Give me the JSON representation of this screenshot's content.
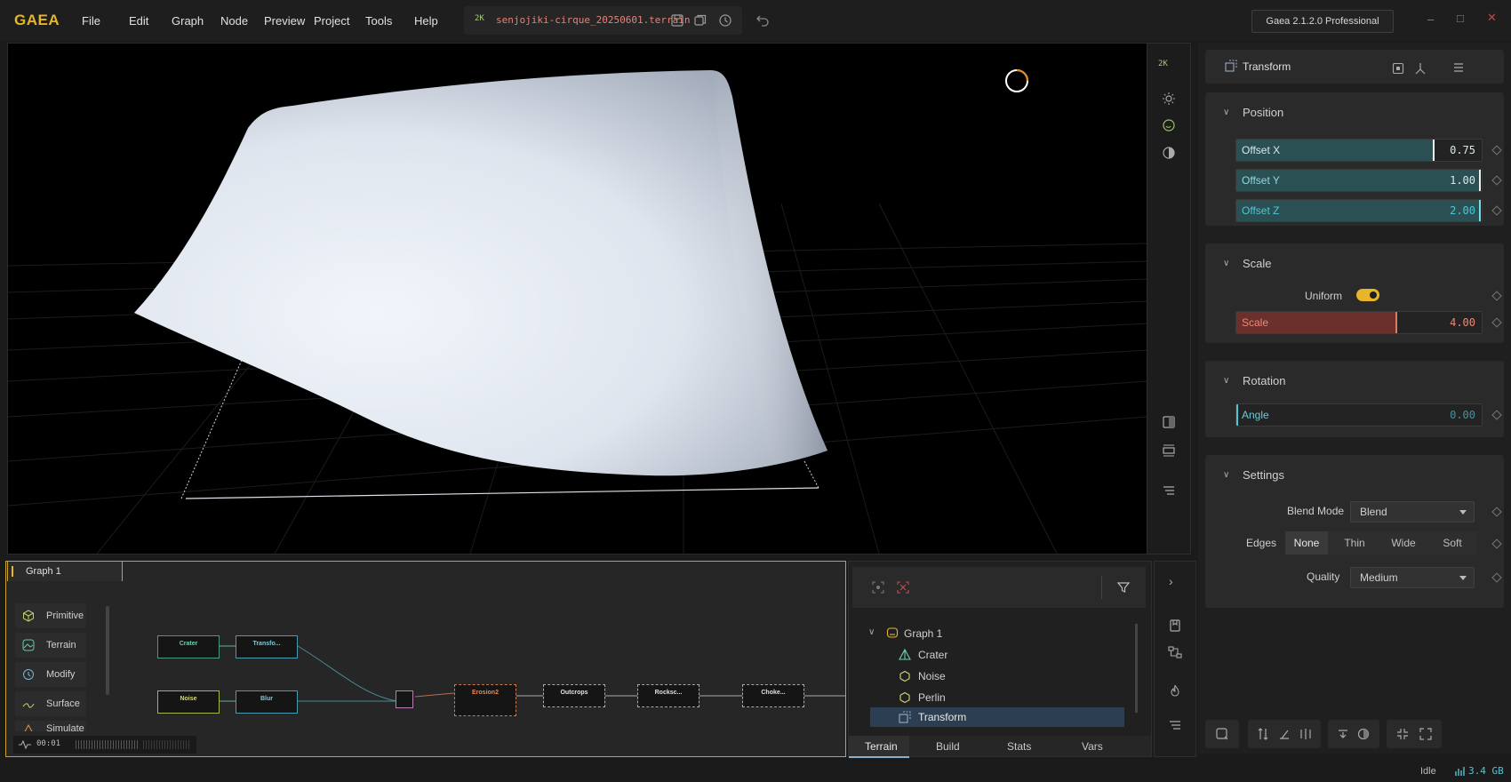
{
  "app": {
    "name": "GAEA",
    "version": "Gaea 2.1.2.0 Professional"
  },
  "menu": [
    "File",
    "Edit",
    "Graph",
    "Node",
    "Preview",
    "Project",
    "Tools",
    "Help"
  ],
  "file": {
    "badge": "2K",
    "name": "senjojiki-cirque_20250601.terrain"
  },
  "viewport": {
    "resolution_badge": "2K"
  },
  "properties": {
    "node_title": "Transform",
    "position": {
      "title": "Position",
      "offset_x": {
        "label": "Offset X",
        "value": "0.75",
        "fraction": 0.8
      },
      "offset_y": {
        "label": "Offset Y",
        "value": "1.00",
        "fraction": 1.0
      },
      "offset_z": {
        "label": "Offset Z",
        "value": "2.00",
        "fraction": 1.0
      }
    },
    "scale": {
      "title": "Scale",
      "uniform_label": "Uniform",
      "uniform_on": true,
      "scale": {
        "label": "Scale",
        "value": "4.00",
        "fraction": 0.65
      }
    },
    "rotation": {
      "title": "Rotation",
      "angle": {
        "label": "Angle",
        "value": "0.00",
        "fraction": 0
      }
    },
    "settings": {
      "title": "Settings",
      "blend_mode_label": "Blend Mode",
      "blend_mode_value": "Blend",
      "edges_label": "Edges",
      "edges_options": [
        "None",
        "Thin",
        "Wide",
        "Soft"
      ],
      "edges_selected": "None",
      "quality_label": "Quality",
      "quality_value": "Medium"
    }
  },
  "graph": {
    "tab": "Graph 1",
    "categories": [
      "Primitive",
      "Terrain",
      "Modify",
      "Surface",
      "Simulate"
    ],
    "timer": "00:01",
    "nodes": {
      "crater": "Crater",
      "transform": "Transfo...",
      "noise": "Noise",
      "blur": "Blur",
      "erosion": "Erosion2",
      "outcrops": "Outcrops",
      "rockscape": "Rocksc...",
      "choke": "Choke..."
    }
  },
  "tree": {
    "root": "Graph 1",
    "items": [
      "Crater",
      "Noise",
      "Perlin",
      "Transform"
    ],
    "selected": "Transform",
    "tabs": [
      "Terrain",
      "Build",
      "Stats",
      "Vars"
    ],
    "active_tab": "Terrain"
  },
  "status": {
    "state": "Idle",
    "memory": "3.4 GB"
  },
  "colors": {
    "accent": "#e6b62a",
    "offset_fill": "#2b5054",
    "scale_fill": "#6b2f2c",
    "selected_row": "#2c3f52"
  }
}
